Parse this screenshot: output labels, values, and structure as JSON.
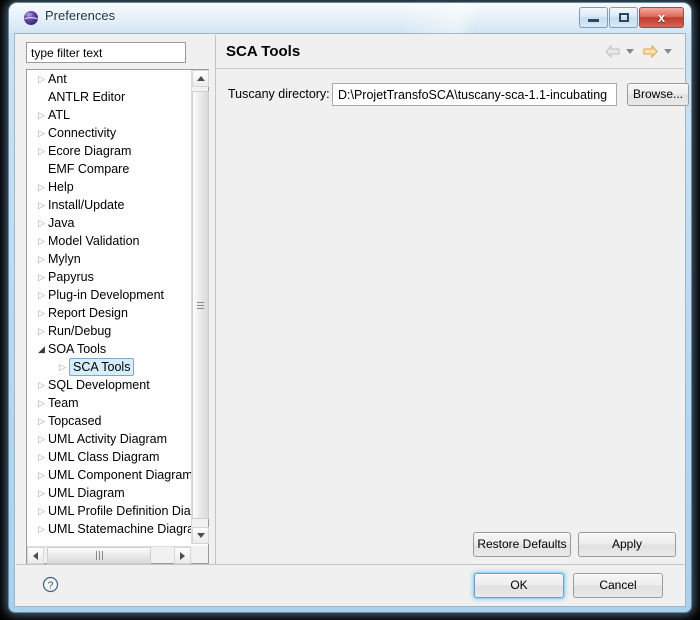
{
  "window": {
    "title": "Preferences",
    "icon": "eclipse-globe-icon",
    "controls": {
      "minimize": "–",
      "maximize": "□",
      "close": "x"
    }
  },
  "sidebar": {
    "filter": {
      "value": "type filter text",
      "placeholder": "type filter text"
    },
    "tree": [
      {
        "label": "Ant",
        "indent": 0,
        "state": "collapsed"
      },
      {
        "label": "ANTLR Editor",
        "indent": 0,
        "state": "leaf"
      },
      {
        "label": "ATL",
        "indent": 0,
        "state": "collapsed"
      },
      {
        "label": "Connectivity",
        "indent": 0,
        "state": "collapsed"
      },
      {
        "label": "Ecore Diagram",
        "indent": 0,
        "state": "collapsed"
      },
      {
        "label": "EMF Compare",
        "indent": 0,
        "state": "leaf"
      },
      {
        "label": "Help",
        "indent": 0,
        "state": "collapsed"
      },
      {
        "label": "Install/Update",
        "indent": 0,
        "state": "collapsed"
      },
      {
        "label": "Java",
        "indent": 0,
        "state": "collapsed"
      },
      {
        "label": "Model Validation",
        "indent": 0,
        "state": "collapsed"
      },
      {
        "label": "Mylyn",
        "indent": 0,
        "state": "collapsed"
      },
      {
        "label": "Papyrus",
        "indent": 0,
        "state": "collapsed"
      },
      {
        "label": "Plug-in Development",
        "indent": 0,
        "state": "collapsed"
      },
      {
        "label": "Report Design",
        "indent": 0,
        "state": "collapsed"
      },
      {
        "label": "Run/Debug",
        "indent": 0,
        "state": "collapsed"
      },
      {
        "label": "SOA Tools",
        "indent": 0,
        "state": "expanded"
      },
      {
        "label": "SCA Tools",
        "indent": 1,
        "state": "collapsed",
        "selected": true
      },
      {
        "label": "SQL Development",
        "indent": 0,
        "state": "collapsed"
      },
      {
        "label": "Team",
        "indent": 0,
        "state": "collapsed"
      },
      {
        "label": "Topcased",
        "indent": 0,
        "state": "collapsed"
      },
      {
        "label": "UML Activity Diagram",
        "indent": 0,
        "state": "collapsed"
      },
      {
        "label": "UML Class Diagram",
        "indent": 0,
        "state": "collapsed"
      },
      {
        "label": "UML Component Diagram",
        "indent": 0,
        "state": "collapsed"
      },
      {
        "label": "UML Diagram",
        "indent": 0,
        "state": "collapsed"
      },
      {
        "label": "UML Profile Definition Diagram",
        "indent": 0,
        "state": "collapsed"
      },
      {
        "label": "UML Statemachine Diagram",
        "indent": 0,
        "state": "collapsed"
      }
    ]
  },
  "page": {
    "title": "SCA Tools",
    "nav": {
      "back_icon": "back-arrow-icon",
      "forward_icon": "forward-arrow-icon"
    },
    "field": {
      "label": "Tuscany directory:",
      "value": "D:\\ProjetTransfoSCA\\tuscany-sca-1.1-incubating",
      "browse_label": "Browse..."
    },
    "restore_defaults_label": "Restore Defaults",
    "apply_label": "Apply"
  },
  "footer": {
    "help_icon": "help-question-icon",
    "ok_label": "OK",
    "cancel_label": "Cancel"
  },
  "colors": {
    "selection_fill": "#d6eefb",
    "selection_border": "#7aacc9",
    "forward_arrow": "#f0ad4e",
    "back_arrow": "#c8c8c8",
    "window_glass": "#bfdcf2"
  }
}
